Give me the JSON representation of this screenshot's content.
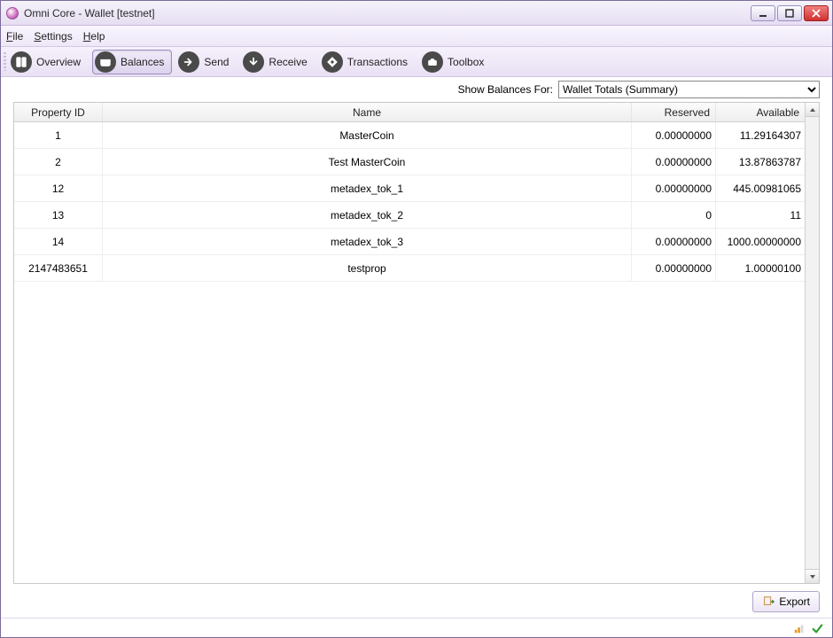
{
  "window": {
    "title": "Omni Core - Wallet [testnet]"
  },
  "menu": {
    "file": "File",
    "settings": "Settings",
    "help": "Help"
  },
  "toolbar": {
    "overview": "Overview",
    "balances": "Balances",
    "send": "Send",
    "receive": "Receive",
    "transactions": "Transactions",
    "toolbox": "Toolbox"
  },
  "subbar": {
    "label": "Show Balances For:",
    "selected": "Wallet Totals (Summary)"
  },
  "table": {
    "headers": {
      "property_id": "Property ID",
      "name": "Name",
      "reserved": "Reserved",
      "available": "Available"
    },
    "rows": [
      {
        "id": "1",
        "name": "MasterCoin",
        "reserved": "0.00000000",
        "available": "11.29164307"
      },
      {
        "id": "2",
        "name": "Test MasterCoin",
        "reserved": "0.00000000",
        "available": "13.87863787"
      },
      {
        "id": "12",
        "name": "metadex_tok_1",
        "reserved": "0.00000000",
        "available": "445.00981065"
      },
      {
        "id": "13",
        "name": "metadex_tok_2",
        "reserved": "0",
        "available": "11"
      },
      {
        "id": "14",
        "name": "metadex_tok_3",
        "reserved": "0.00000000",
        "available": "1000.00000000"
      },
      {
        "id": "2147483651",
        "name": "testprop",
        "reserved": "0.00000000",
        "available": "1.00000100"
      }
    ]
  },
  "export": {
    "label": "Export"
  }
}
